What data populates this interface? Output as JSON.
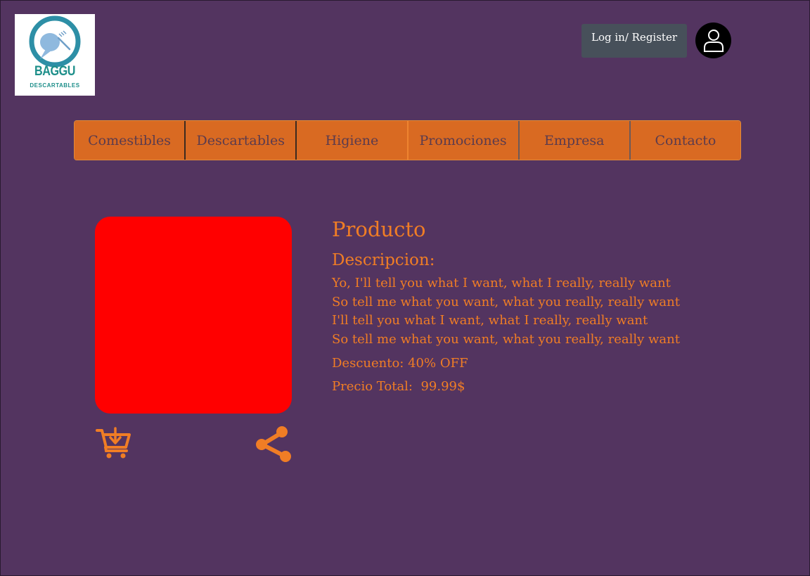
{
  "brand": {
    "name": "BAGGU",
    "tagline": "DESCARTABLES"
  },
  "header": {
    "login_label": "Log in/ Register"
  },
  "nav": {
    "items": [
      {
        "label": "Comestibles"
      },
      {
        "label": "Descartables"
      },
      {
        "label": "Higiene"
      },
      {
        "label": "Promociones"
      },
      {
        "label": "Empresa"
      },
      {
        "label": "Contacto"
      }
    ]
  },
  "product": {
    "title": "Producto",
    "description_heading": "Descripcion:",
    "description_lines": [
      "Yo, I'll tell you what I want, what I really, really want",
      "So tell me what you want, what you really, really want",
      "I'll tell you what I want, what I really, really want",
      "So tell me what you want, what you really, really want"
    ],
    "discount": "Descuento: 40% OFF",
    "price": "Precio Total:  99.99$"
  },
  "icons": {
    "logo": "logo-icon",
    "avatar": "user-icon",
    "cart": "add-to-cart-icon",
    "share": "share-icon"
  },
  "colors": {
    "background": "#533460",
    "nav_background": "#d96a22",
    "accent_text": "#f07d25",
    "login_button": "#47505a",
    "product_image": "#ff0000",
    "brand_teal": "#1e8f8a"
  }
}
